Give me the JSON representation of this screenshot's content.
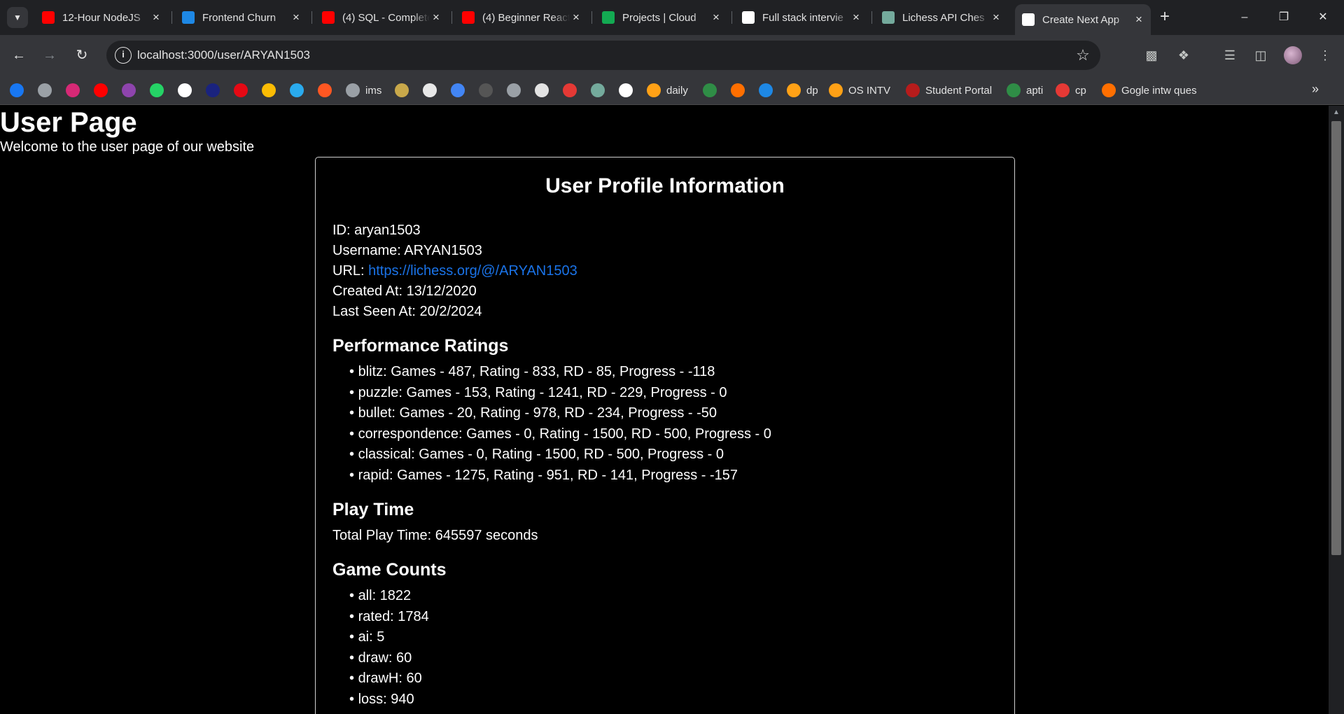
{
  "browser": {
    "tabs": [
      {
        "title": "12-Hour NodeJS",
        "favicon": "youtube-icon",
        "color": "#ff0000"
      },
      {
        "title": "Frontend Churn",
        "favicon": "ac-icon",
        "color": "#1e88e5"
      },
      {
        "title": "(4) SQL - Complete",
        "favicon": "youtube-icon",
        "color": "#ff0000"
      },
      {
        "title": "(4) Beginner React",
        "favicon": "youtube-icon",
        "color": "#ff0000"
      },
      {
        "title": "Projects | Cloud",
        "favicon": "mongodb-icon",
        "color": "#13aa52"
      },
      {
        "title": "Full stack intervie",
        "favicon": "notion-icon",
        "color": "#ffffff"
      },
      {
        "title": "Lichess API Ches",
        "favicon": "chatgpt-icon",
        "color": "#74aa9c"
      },
      {
        "title": "Create Next App",
        "favicon": "nextjs-icon",
        "color": "#ffffff"
      }
    ],
    "url": "localhost:3000/user/ARYAN1503",
    "bookmarks": [
      {
        "label": "",
        "icon": "facebook-icon",
        "color": "#1877f2"
      },
      {
        "label": "",
        "icon": "globe-icon",
        "color": "#9aa0a6"
      },
      {
        "label": "",
        "icon": "instagram-icon",
        "color": "#d62976"
      },
      {
        "label": "",
        "icon": "youtube-icon",
        "color": "#ff0000"
      },
      {
        "label": "",
        "icon": "pw-icon",
        "color": "#8e44ad"
      },
      {
        "label": "",
        "icon": "whatsapp-icon",
        "color": "#25d366"
      },
      {
        "label": "",
        "icon": "amazon-icon",
        "color": "#ffffff"
      },
      {
        "label": "",
        "icon": "dh-icon",
        "color": "#1a237e"
      },
      {
        "label": "",
        "icon": "netflix-icon",
        "color": "#e50914"
      },
      {
        "label": "",
        "icon": "photos-icon",
        "color": "#fbbc04"
      },
      {
        "label": "",
        "icon": "telegram-icon",
        "color": "#2aabee"
      },
      {
        "label": "",
        "icon": "x-icon",
        "color": "#ff5722"
      },
      {
        "label": "ims",
        "icon": "globe-icon",
        "color": "#9aa0a6"
      },
      {
        "label": "",
        "icon": "emblem-icon",
        "color": "#c8a84a"
      },
      {
        "label": "",
        "icon": "cc-icon",
        "color": "#e8e8e8"
      },
      {
        "label": "",
        "icon": "chart-icon",
        "color": "#4285f4"
      },
      {
        "label": "",
        "icon": "blank-icon",
        "color": "#555555"
      },
      {
        "label": "",
        "icon": "globe-icon",
        "color": "#9aa0a6"
      },
      {
        "label": "",
        "icon": "ai-icon",
        "color": "#e3e3e3"
      },
      {
        "label": "",
        "icon": "tuf-icon",
        "color": "#e53935"
      },
      {
        "label": "",
        "icon": "chatgpt-icon",
        "color": "#74aa9c"
      },
      {
        "label": "",
        "icon": "github-icon",
        "color": "#ffffff"
      },
      {
        "label": "daily",
        "icon": "leetcode-icon",
        "color": "#ffa116"
      },
      {
        "label": "",
        "icon": "gfg-icon",
        "color": "#2f8d46"
      },
      {
        "label": "",
        "icon": "cc-orange-icon",
        "color": "#ff6f00"
      },
      {
        "label": "",
        "icon": "s-icon",
        "color": "#1e88e5"
      },
      {
        "label": "dp",
        "icon": "leetcode-icon",
        "color": "#ffa116"
      },
      {
        "label": "OS INTV",
        "icon": "leetcode-icon",
        "color": "#ffa116"
      },
      {
        "label": "Student Portal",
        "icon": "portal-icon",
        "color": "#b71c1c"
      },
      {
        "label": "apti",
        "icon": "gfg-icon",
        "color": "#2f8d46"
      },
      {
        "label": "cp",
        "icon": "tuf-icon",
        "color": "#e53935"
      },
      {
        "label": "Gogle intw ques",
        "icon": "cc-orange-icon",
        "color": "#ff6f00"
      }
    ]
  },
  "page": {
    "title": "User Page",
    "subtitle": "Welcome to the user page of our website",
    "card_title": "User Profile Information",
    "profile": {
      "id": "ID: aryan1503",
      "username": "Username: ARYAN1503",
      "url_label": "URL: ",
      "url": "https://lichess.org/@/ARYAN1503",
      "created": "Created At: 13/12/2020",
      "last_seen": "Last Seen At: 20/2/2024"
    },
    "perf_heading": "Performance Ratings",
    "perfs": [
      "blitz: Games - 487, Rating - 833, RD - 85, Progress - -118",
      "puzzle: Games - 153, Rating - 1241, RD - 229, Progress - 0",
      "bullet: Games - 20, Rating - 978, RD - 234, Progress - -50",
      "correspondence: Games - 0, Rating - 1500, RD - 500, Progress - 0",
      "classical: Games - 0, Rating - 1500, RD - 500, Progress - 0",
      "rapid: Games - 1275, Rating - 951, RD - 141, Progress - -157"
    ],
    "play_heading": "Play Time",
    "play_total": "Total Play Time: 645597 seconds",
    "counts_heading": "Game Counts",
    "counts": [
      "all: 1822",
      "rated: 1784",
      "ai: 5",
      "draw: 60",
      "drawH: 60",
      "loss: 940"
    ]
  }
}
